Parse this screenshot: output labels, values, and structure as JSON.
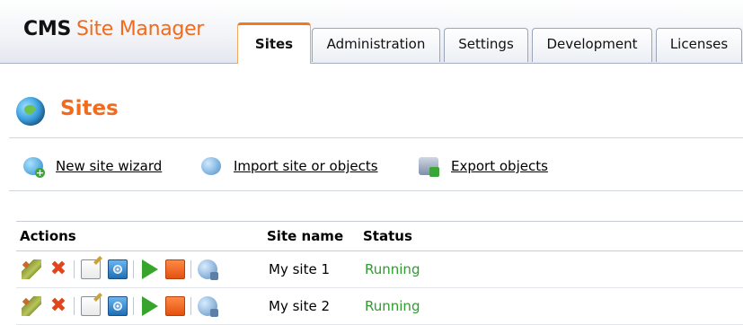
{
  "header": {
    "logo": {
      "cms": "CMS",
      "site_manager": "Site Manager"
    },
    "tabs": [
      {
        "label": "Sites",
        "active": true
      },
      {
        "label": "Administration",
        "active": false
      },
      {
        "label": "Settings",
        "active": false
      },
      {
        "label": "Development",
        "active": false
      },
      {
        "label": "Licenses",
        "active": false
      }
    ]
  },
  "page": {
    "title": "Sites",
    "title_icon": "globe-icon"
  },
  "actions": [
    {
      "label": "New site wizard",
      "icon": "new-site-wizard-icon"
    },
    {
      "label": "Import site or objects",
      "icon": "import-icon"
    },
    {
      "label": "Export objects",
      "icon": "export-icon"
    }
  ],
  "table": {
    "columns": [
      "Actions",
      "Site name",
      "Status"
    ],
    "rows": [
      {
        "site_name": "My site 1",
        "status": "Running"
      },
      {
        "site_name": "My site 2",
        "status": "Running"
      }
    ],
    "row_action_icons": [
      "edit-icon",
      "delete-icon",
      "edit-site-icon",
      "preview-icon",
      "start-icon",
      "stop-icon",
      "export-site-icon"
    ]
  },
  "colors": {
    "accent_orange": "#f26a1b",
    "status_running": "#2e9c2e",
    "tab_active_border": "#f07a1c"
  }
}
